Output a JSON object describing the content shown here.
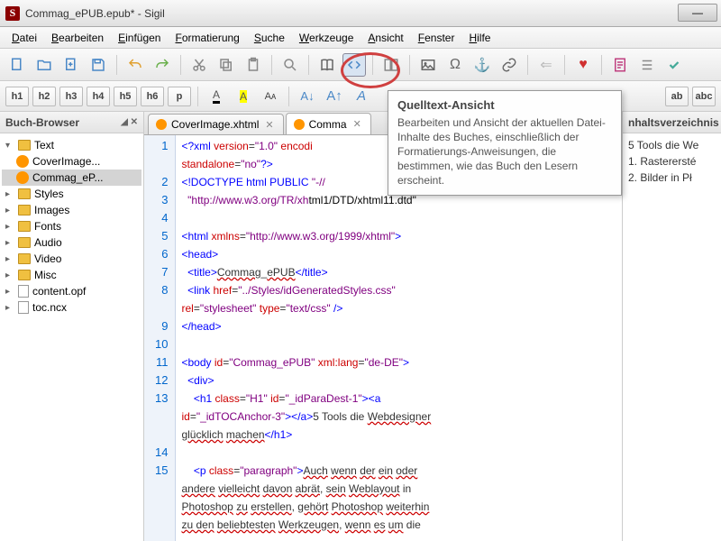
{
  "window": {
    "title": "Commag_ePUB.epub* - Sigil",
    "icon_letter": "S"
  },
  "menu": [
    {
      "label": "Datei",
      "accel": "D"
    },
    {
      "label": "Bearbeiten",
      "accel": "B"
    },
    {
      "label": "Einfügen",
      "accel": "E"
    },
    {
      "label": "Formatierung",
      "accel": "F"
    },
    {
      "label": "Suche",
      "accel": "S"
    },
    {
      "label": "Werkzeuge",
      "accel": "W"
    },
    {
      "label": "Ansicht",
      "accel": "A"
    },
    {
      "label": "Fenster",
      "accel": "F"
    },
    {
      "label": "Hilfe",
      "accel": "H"
    }
  ],
  "toolbar2_buttons": [
    "h1",
    "h2",
    "h3",
    "h4",
    "h5",
    "h6",
    "p"
  ],
  "sidebar": {
    "title": "Buch-Browser",
    "tree": [
      {
        "label": "Text",
        "type": "folder",
        "level": 0,
        "expanded": true
      },
      {
        "label": "CoverImage...",
        "type": "ff",
        "level": 1
      },
      {
        "label": "Commag_eP...",
        "type": "ff",
        "level": 1,
        "selected": true
      },
      {
        "label": "Styles",
        "type": "folder",
        "level": 0
      },
      {
        "label": "Images",
        "type": "folder",
        "level": 0
      },
      {
        "label": "Fonts",
        "type": "folder",
        "level": 0
      },
      {
        "label": "Audio",
        "type": "folder",
        "level": 0
      },
      {
        "label": "Video",
        "type": "folder",
        "level": 0
      },
      {
        "label": "Misc",
        "type": "folder",
        "level": 0
      },
      {
        "label": "content.opf",
        "type": "file",
        "level": 0
      },
      {
        "label": "toc.ncx",
        "type": "file",
        "level": 0
      }
    ]
  },
  "tabs": [
    {
      "label": "CoverImage.xhtml",
      "active": false
    },
    {
      "label": "Comma",
      "active": true,
      "truncated": true
    }
  ],
  "rightpanel": {
    "title": "nhaltsverzeichnis",
    "items": [
      "5 Tools die We",
      "1. Rasterersté",
      "2. Bilder in Pł"
    ]
  },
  "tooltip": {
    "title": "Quelltext-Ansicht",
    "body": "Bearbeiten und Ansicht der aktuellen Datei-Inhalte des Buches, einschließlich der Formatierungs-Anweisungen, die bestimmen, wie das Buch den Lesern erscheint."
  },
  "code": {
    "lines": [
      {
        "n": 1,
        "html": "<span class='c-blue'>&lt;?xml</span> <span class='c-red'>version</span>=<span class='c-purple'>\"1.0\"</span> <span class='c-red'>encodi</span>"
      },
      {
        "n": "",
        "html": "<span class='c-red'>standalone</span>=<span class='c-purple'>\"no\"</span><span class='c-blue'>?&gt;</span>"
      },
      {
        "n": 2,
        "html": "<span class='c-blue'>&lt;!DOCTYPE</span> <span class='c-blue'>html PUBLIC</span> <span class='c-purple'>\"-//</span>"
      },
      {
        "n": 3,
        "html": "  <span class='c-purple'>\"http://www.w3.org/TR/xh</span><span class='c-black'>tml1/DTD/xhtml11.dtd\"</span>"
      },
      {
        "n": 4,
        "html": ""
      },
      {
        "n": 5,
        "html": "<span class='c-blue'>&lt;html</span> <span class='c-red'>xmlns</span>=<span class='c-purple'>\"http://www.w3.org/1999/xhtml\"</span><span class='c-blue'>&gt;</span>"
      },
      {
        "n": 6,
        "html": "<span class='c-blue'>&lt;head&gt;</span>"
      },
      {
        "n": 7,
        "html": "  <span class='c-blue'>&lt;title&gt;</span><span class='wavy'>Commag</span>_<span class='wavy'>ePUB</span><span class='c-blue'>&lt;/title&gt;</span>"
      },
      {
        "n": 8,
        "html": "  <span class='c-blue'>&lt;link</span> <span class='c-red'>href</span>=<span class='c-purple'>\"../Styles/idGeneratedStyles.css\"</span>"
      },
      {
        "n": "",
        "html": "<span class='c-red'>rel</span>=<span class='c-purple'>\"stylesheet\"</span> <span class='c-red'>type</span>=<span class='c-purple'>\"text/css\"</span> <span class='c-blue'>/&gt;</span>"
      },
      {
        "n": 9,
        "html": "<span class='c-blue'>&lt;/head&gt;</span>"
      },
      {
        "n": 10,
        "html": ""
      },
      {
        "n": 11,
        "html": "<span class='c-blue'>&lt;body</span> <span class='c-red'>id</span>=<span class='c-purple'>\"Commag_ePUB\"</span> <span class='c-red'>xml:lang</span>=<span class='c-purple'>\"de-DE\"</span><span class='c-blue'>&gt;</span>"
      },
      {
        "n": 12,
        "html": "  <span class='c-blue'>&lt;div&gt;</span>"
      },
      {
        "n": 13,
        "html": "    <span class='c-blue'>&lt;h1</span> <span class='c-red'>class</span>=<span class='c-purple'>\"H1\"</span> <span class='c-red'>id</span>=<span class='c-purple'>\"_idParaDest-1\"</span><span class='c-blue'>&gt;&lt;a</span>"
      },
      {
        "n": "",
        "html": "<span class='c-red'>id</span>=<span class='c-purple'>\"_idTOCAnchor-3\"</span><span class='c-blue'>&gt;&lt;/a&gt;</span>5 Tools die <span class='wavy'>Webdesigner</span>"
      },
      {
        "n": "",
        "html": "<span class='wavy'>glücklich</span> <span class='wavy'>machen</span><span class='c-blue'>&lt;/h1&gt;</span>"
      },
      {
        "n": 14,
        "html": ""
      },
      {
        "n": 15,
        "html": "    <span class='c-blue'>&lt;p</span> <span class='c-red'>class</span>=<span class='c-purple'>\"paragraph\"</span><span class='c-blue'>&gt;</span><span class='wavy'>Auch</span> <span class='wavy'>wenn</span> <span class='wavy'>der</span> <span class='wavy'>ein</span> <span class='wavy'>oder</span>"
      },
      {
        "n": "",
        "html": "<span class='wavy'>andere</span> <span class='wavy'>vielleicht</span> <span class='wavy'>davon</span> <span class='wavy'>abrät</span>, <span class='wavy'>sein</span> <span class='wavy'>Weblayout</span> in"
      },
      {
        "n": "",
        "html": "<span class='wavy'>Photoshop</span> <span class='wavy'>zu</span> <span class='wavy'>erstellen</span>, <span class='wavy'>gehört</span> <span class='wavy'>Photoshop</span> <span class='wavy'>weiterhin</span>"
      },
      {
        "n": "",
        "html": "<span class='wavy'>zu den</span> <span class='wavy'>beliebtesten</span> <span class='wavy'>Werkzeugen</span>, <span class='wavy'>wenn</span> <span class='wavy'>es</span> <span class='wavy'>um</span> die"
      }
    ]
  }
}
